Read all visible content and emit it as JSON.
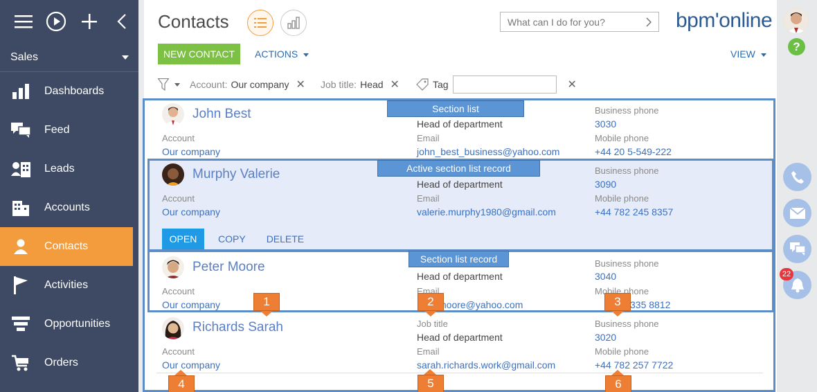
{
  "sidebar": {
    "workspace": "Sales",
    "items": [
      {
        "label": "Dashboards",
        "icon": "dashboards-icon"
      },
      {
        "label": "Feed",
        "icon": "feed-icon"
      },
      {
        "label": "Leads",
        "icon": "leads-icon"
      },
      {
        "label": "Accounts",
        "icon": "accounts-icon"
      },
      {
        "label": "Contacts",
        "icon": "contacts-icon",
        "active": true
      },
      {
        "label": "Activities",
        "icon": "activities-icon"
      },
      {
        "label": "Opportunities",
        "icon": "opportunities-icon"
      },
      {
        "label": "Orders",
        "icon": "orders-icon"
      }
    ]
  },
  "header": {
    "title": "Contacts",
    "search_placeholder": "What can I do for you?",
    "logo": "bpm'online"
  },
  "toolbar": {
    "new_label": "NEW CONTACT",
    "actions_label": "ACTIONS",
    "view_label": "VIEW"
  },
  "filters": {
    "account_label": "Account:",
    "account_value": "Our company",
    "job_label": "Job title:",
    "job_value": "Head",
    "tag_label": "Tag"
  },
  "records": [
    {
      "name": "John Best",
      "job": "Head of department",
      "account_label": "Account",
      "account": "Our company",
      "email_label": "Email",
      "email": "john_best_business@yahoo.com",
      "bphone_label": "Business phone",
      "bphone": "3030",
      "mphone_label": "Mobile phone",
      "mphone": "+44 20 5-549-222"
    },
    {
      "name": "Murphy Valerie",
      "job": "Head of department",
      "account_label": "Account",
      "account": "Our company",
      "email_label": "Email",
      "email": "valerie.murphy1980@gmail.com",
      "bphone_label": "Business phone",
      "bphone": "3090",
      "mphone_label": "Mobile phone",
      "mphone": "+44 782 245 8357"
    },
    {
      "name": "Peter Moore",
      "job": "Head of department",
      "account_label": "Account",
      "account": "Our company",
      "email_label": "Email",
      "email": "moore@yahoo.com",
      "bphone_label": "Business phone",
      "bphone": "3040",
      "mphone_label": "Mobile phone",
      "mphone": "335 8812"
    },
    {
      "name": "Richards Sarah",
      "job_label": "Job title",
      "job": "Head of department",
      "account_label": "Account",
      "account": "Our company",
      "email_label": "Email",
      "email": "sarah.richards.work@gmail.com",
      "bphone_label": "Business phone",
      "bphone": "3020",
      "mphone_label": "Mobile phone",
      "mphone": "+44 782 257 7722"
    }
  ],
  "record_actions": {
    "open": "OPEN",
    "copy": "COPY",
    "delete": "DELETE"
  },
  "annotations": {
    "section_list": "Section list",
    "active_record": "Active section list record",
    "section_record": "Section list record",
    "numbers": [
      "1",
      "2",
      "3",
      "4",
      "5",
      "6"
    ]
  },
  "notifications_count": "22",
  "colors": {
    "sidebar": "#3e4a63",
    "accent": "#f39c3e",
    "link": "#3a70c2",
    "new_button": "#7cc144",
    "callout": "#5b95d6",
    "marker": "#ee7e33"
  }
}
